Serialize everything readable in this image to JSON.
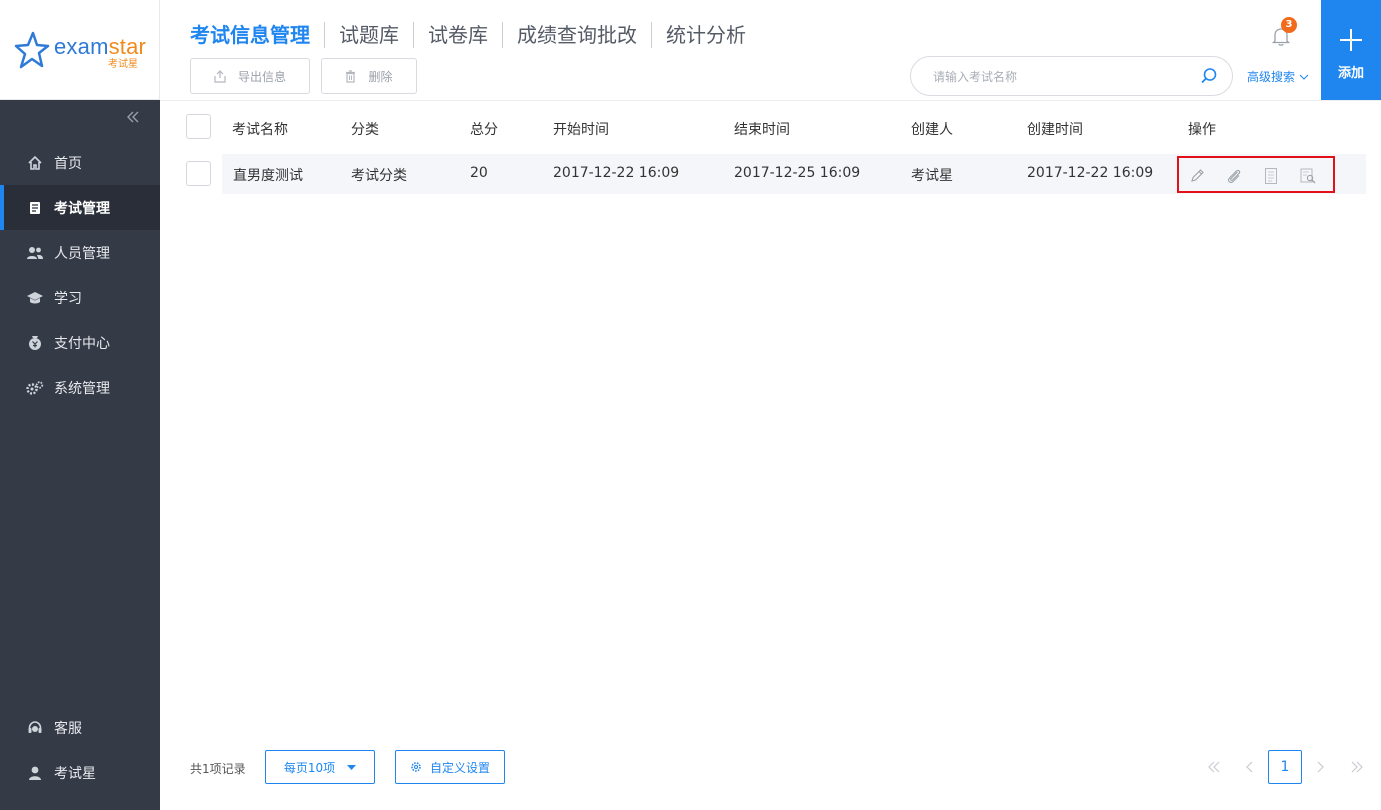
{
  "brand": {
    "name_part1": "exam",
    "name_part2": "star",
    "subtitle": "考试星"
  },
  "header": {
    "tabs": [
      {
        "label": "考试信息管理"
      },
      {
        "label": "试题库"
      },
      {
        "label": "试卷库"
      },
      {
        "label": "成绩查询批改"
      },
      {
        "label": "统计分析"
      }
    ],
    "toolbar": {
      "export_label": "导出信息",
      "delete_label": "删除"
    },
    "search": {
      "placeholder": "请输入考试名称"
    },
    "advanced_search_label": "高级搜索",
    "notification_count": "3",
    "add_label": "添加"
  },
  "sidebar": {
    "items": [
      {
        "label": "首页",
        "icon": "home-icon"
      },
      {
        "label": "考试管理",
        "icon": "exam-icon"
      },
      {
        "label": "人员管理",
        "icon": "users-icon"
      },
      {
        "label": "学习",
        "icon": "graduation-cap-icon"
      },
      {
        "label": "支付中心",
        "icon": "payment-icon"
      },
      {
        "label": "系统管理",
        "icon": "gears-icon"
      }
    ],
    "bottom_items": [
      {
        "label": "客服",
        "icon": "headset-icon"
      },
      {
        "label": "考试星",
        "icon": "user-icon"
      }
    ]
  },
  "table": {
    "columns": [
      "考试名称",
      "分类",
      "总分",
      "开始时间",
      "结束时间",
      "创建人",
      "创建时间",
      "操作"
    ],
    "rows": [
      {
        "name": "直男度测试",
        "category": "考试分类",
        "score": "20",
        "start": "2017-12-22 16:09",
        "end": "2017-12-25 16:09",
        "creator": "考试星",
        "created": "2017-12-22 16:09"
      }
    ]
  },
  "footer": {
    "total_label": "共1项记录",
    "per_page_label": "每页10项",
    "custom_settings_label": "自定义设置",
    "current_page": "1"
  },
  "colors": {
    "accent": "#1f86f0",
    "sidebar": "#353a47",
    "highlight": "#e3101a",
    "badge": "#f26a1b"
  }
}
